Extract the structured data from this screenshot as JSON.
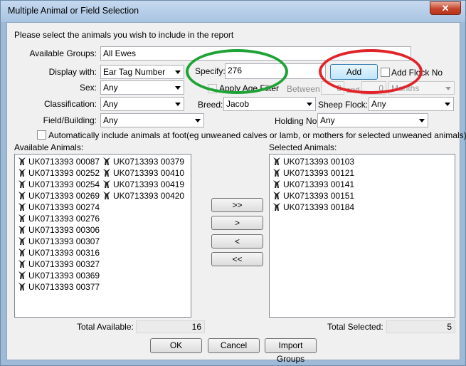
{
  "window": {
    "title": "Multiple Animal or Field Selection",
    "close_glyph": "✕"
  },
  "instruction": "Please select the animals you wish to include in the report",
  "available_groups": {
    "label": "Available Groups:",
    "value": "All Ewes"
  },
  "display_with": {
    "label": "Display with:",
    "value": "Ear Tag Number"
  },
  "specify": {
    "label": "Specify:",
    "value": "276"
  },
  "add_button": "Add",
  "add_flock_no": "Add Flock No",
  "sex": {
    "label": "Sex:",
    "value": "Any"
  },
  "apply_age_filter": "Apply Age Filter",
  "between": {
    "label": "Between",
    "from": "0",
    "and_label": "and",
    "to": "0",
    "unit": "Months"
  },
  "classification": {
    "label": "Classification:",
    "value": "Any"
  },
  "breed": {
    "label": "Breed:",
    "value": "Jacob"
  },
  "sheep_flock": {
    "label": "Sheep Flock:",
    "value": "Any"
  },
  "field_building": {
    "label": "Field/Building:",
    "value": "Any"
  },
  "holding_no": {
    "label": "Holding No:",
    "value": "Any"
  },
  "auto_include": "Automatically include animals at foot(eg unweaned calves or lamb, or mothers for selected unweaned animals)",
  "available_animals": {
    "label": "Available Animals:",
    "icon": "sheep-icon",
    "items": [
      "UK0713393 00087",
      "UK0713393 00252",
      "UK0713393 00254",
      "UK0713393 00269",
      "UK0713393 00274",
      "UK0713393 00276",
      "UK0713393 00306",
      "UK0713393 00307",
      "UK0713393 00316",
      "UK0713393 00327",
      "UK0713393 00369",
      "UK0713393 00377",
      "UK0713393 00379",
      "UK0713393 00410",
      "UK0713393 00419",
      "UK0713393 00420"
    ]
  },
  "transfer_buttons": [
    ">>",
    ">",
    "<",
    "<<"
  ],
  "selected_animals": {
    "label": "Selected Animals:",
    "icon": "sheep-icon",
    "items": [
      "UK0713393 00103",
      "UK0713393 00121",
      "UK0713393 00141",
      "UK0713393 00151",
      "UK0713393 00184"
    ]
  },
  "total_available": {
    "label": "Total Available:",
    "value": "16"
  },
  "total_selected": {
    "label": "Total Selected:",
    "value": "5"
  },
  "buttons": {
    "ok": "OK",
    "cancel": "Cancel",
    "import_groups": "Import Groups"
  },
  "annotation_colors": {
    "green": "#1fa336",
    "red": "#e0242a"
  }
}
